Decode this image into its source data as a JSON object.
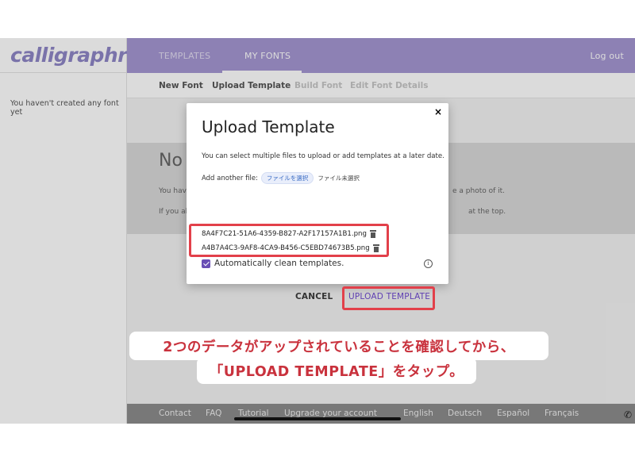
{
  "app": {
    "logo": "calligraphr",
    "sidebar_empty_text": "You haven't created any font yet"
  },
  "topbar": {
    "templates": "TEMPLATES",
    "my_fonts": "MY FONTS",
    "logout": "Log out"
  },
  "subnav": {
    "new_font": "New Font",
    "upload_template": "Upload Template",
    "build_font": "Build Font",
    "edit_font_details": "Edit Font Details"
  },
  "background_panel": {
    "heading": "No",
    "line1_start": "You hav",
    "line1_end": "e a photo of it.",
    "line2_start": "If you al",
    "line2_end": "at the top."
  },
  "modal": {
    "title": "Upload Template",
    "description": "You can select multiple files to upload or add templates at a later date.",
    "add_file_label": "Add another file:",
    "choose_file_button": "ファイルを選択",
    "no_file_selected": "ファイル未選択",
    "files": [
      "8A4F7C21-51A6-4359-B827-A2F17157A1B1.png",
      "A4B7A4C3-9AF8-4CA9-B456-C5EBD74673B5.png"
    ],
    "auto_clean_label": "Automatically clean templates.",
    "auto_clean_checked": true,
    "info_icon": "i",
    "close_icon": "×",
    "cancel": "CANCEL",
    "upload": "UPLOAD TEMPLATE"
  },
  "footer": {
    "links": [
      "Contact",
      "FAQ",
      "Tutorial",
      "Upgrade your account",
      "English",
      "Deutsch",
      "Español",
      "Français"
    ]
  },
  "caption": {
    "line1": "2つのデータがアップされていることを確認してから、",
    "line2": "「UPLOAD  TEMPLATE」をタップ。"
  },
  "colors": {
    "topbar": "#a597d2",
    "accent": "#5f3fb2",
    "highlight": "#e2404a",
    "caption_text": "#c9323d"
  }
}
